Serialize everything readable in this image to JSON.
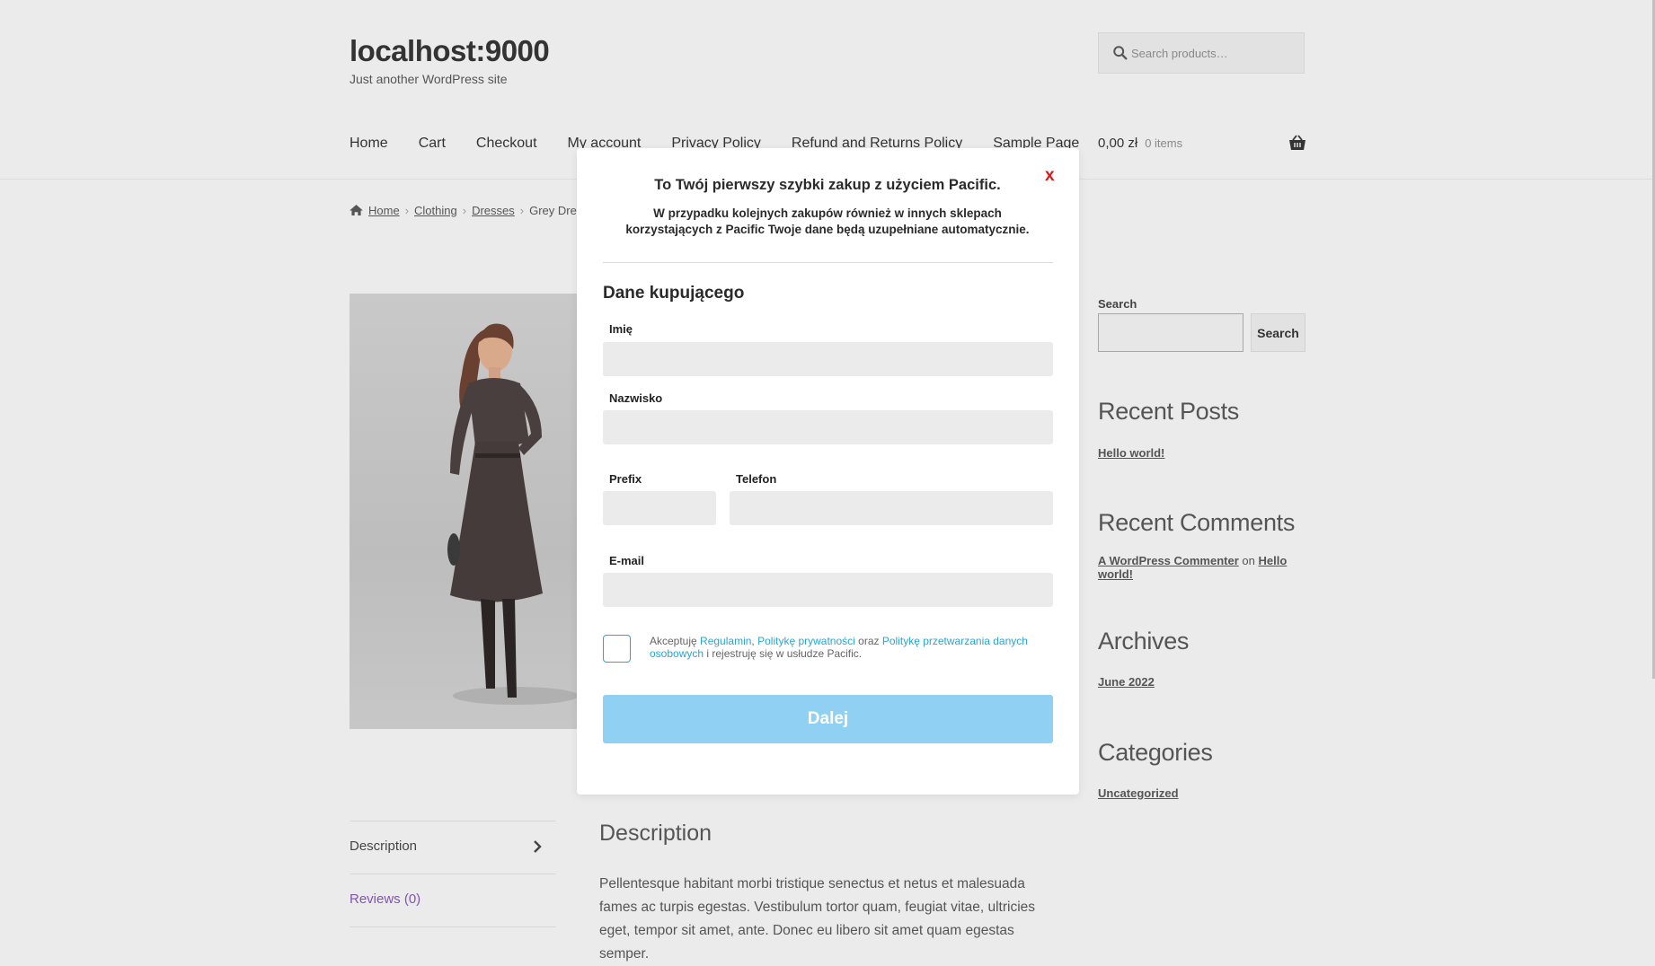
{
  "site": {
    "title": "localhost:9000",
    "description": "Just another WordPress site"
  },
  "search": {
    "placeholder": "Search products…"
  },
  "nav": {
    "items": [
      "Home",
      "Cart",
      "Checkout",
      "My account",
      "Privacy Policy",
      "Refund and Returns Policy",
      "Sample Page"
    ]
  },
  "cart": {
    "total": "0,00 zł",
    "items": "0 items"
  },
  "breadcrumb": {
    "items": [
      "Home",
      "Clothing",
      "Dresses"
    ],
    "current": "Grey Dres"
  },
  "sidebar": {
    "search_label": "Search",
    "search_button": "Search",
    "recent_posts": {
      "title": "Recent Posts",
      "items": [
        "Hello world!"
      ]
    },
    "recent_comments": {
      "title": "Recent Comments",
      "author": "A WordPress Commenter",
      "on": "on",
      "post_line1": "Hello",
      "post_line2": "world!"
    },
    "archives": {
      "title": "Archives",
      "items": [
        "June 2022"
      ]
    },
    "categories": {
      "title": "Categories",
      "items": [
        "Uncategorized"
      ]
    }
  },
  "tabs": {
    "description": "Description",
    "reviews": "Reviews (0)"
  },
  "description": {
    "title": "Description",
    "text": "Pellentesque habitant morbi tristique senectus et netus et malesuada fames ac turpis egestas. Vestibulum tortor quam, feugiat vitae, ultricies eget, tempor sit amet, ante. Donec eu libero sit amet quam egestas semper."
  },
  "modal": {
    "close": "x",
    "title": "To Twój pierwszy szybki zakup z użyciem Pacific.",
    "subtitle_line1": "W przypadku kolejnych zakupów również w innych sklepach",
    "subtitle_line2": "korzystających z Pacific Twoje dane będą uzupełniane automatycznie.",
    "heading": "Dane kupującego",
    "fields": {
      "first_name": "Imię",
      "last_name": "Nazwisko",
      "prefix": "Prefix",
      "phone": "Telefon",
      "email": "E-mail"
    },
    "values": {
      "first_name": "",
      "last_name": "",
      "prefix": "",
      "phone": "",
      "email": ""
    },
    "consent": {
      "text1": "Akceptuję",
      "link1": "Regulamin",
      "comma": ",",
      "link2": "Politykę prywatności",
      "and": "oraz",
      "link3": "Politykę przetwarzania danych osobowych",
      "text2": "i rejestruję się w usłudze Pacific."
    },
    "button": "Dalej"
  },
  "colors": {
    "accent": "#2aa5d4",
    "button": "#90d1f3",
    "close": "#e01515",
    "link_purple": "#7f54b3"
  }
}
